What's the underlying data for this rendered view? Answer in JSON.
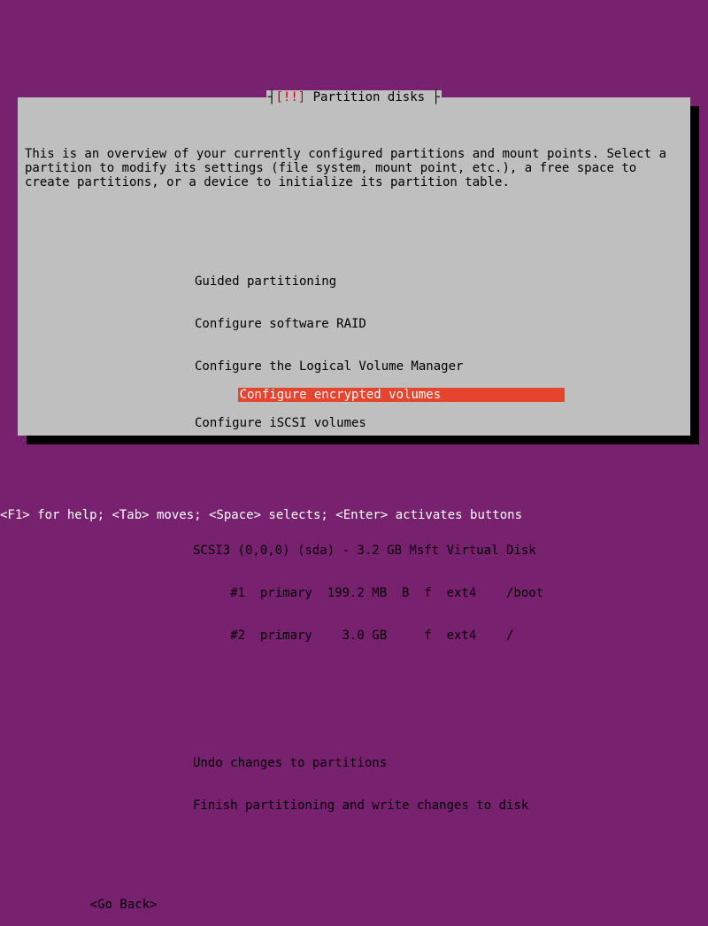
{
  "title": {
    "bracket_open": "┤",
    "bang": "[!!]",
    "label": " Partition disks ",
    "bracket_close": "├"
  },
  "instructions": "This is an overview of your currently configured partitions and mount points. Select a partition to modify its settings (file system, mount point, etc.), a free space to create partitions, or a device to initialize its partition table.",
  "menu": {
    "items": [
      "Guided partitioning",
      "Configure software RAID",
      "Configure the Logical Volume Manager",
      "Configure encrypted volumes",
      "Configure iSCSI volumes"
    ],
    "selected_index": 3
  },
  "disk": {
    "header": "SCSI3 (0,0,0) (sda) - 3.2 GB Msft Virtual Disk",
    "partitions": [
      "     #1  primary  199.2 MB  B  f  ext4    /boot",
      "     #2  primary    3.0 GB     f  ext4    /"
    ]
  },
  "actions": [
    "Undo changes to partitions",
    "Finish partitioning and write changes to disk"
  ],
  "goback": "<Go Back>",
  "footer": "<F1> for help; <Tab> moves; <Space> selects; <Enter> activates buttons"
}
